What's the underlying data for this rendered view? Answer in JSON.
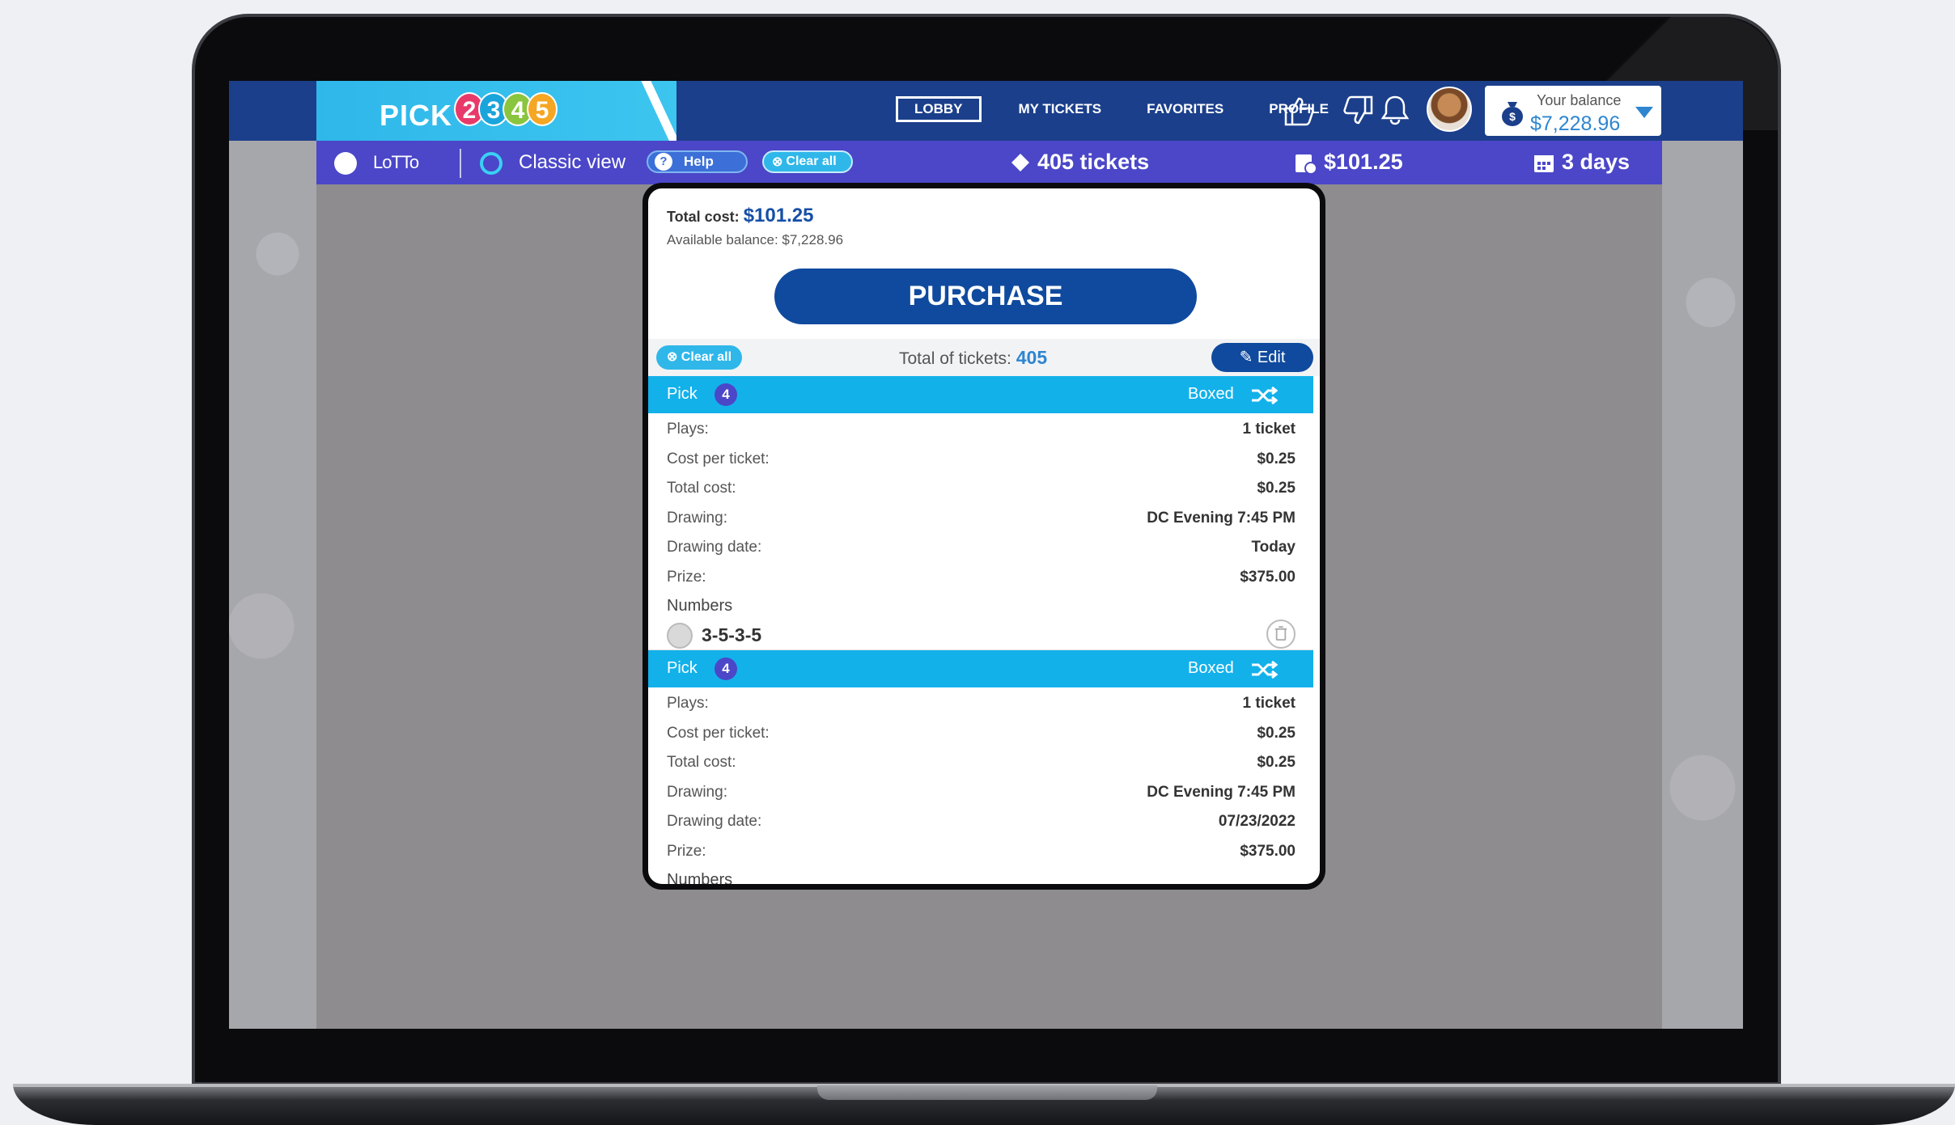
{
  "top_nav": {
    "logo_text": "PICK",
    "logo_digits": [
      "2",
      "3",
      "4",
      "5"
    ],
    "logo_colors": [
      "#e83a6a",
      "#1aa4dc",
      "#8ac53f",
      "#f5a623"
    ],
    "items": [
      {
        "label": "LOBBY",
        "active": true
      },
      {
        "label": "MY TICKETS",
        "active": false
      },
      {
        "label": "FAVORITES",
        "active": false
      },
      {
        "label": "PROFILE",
        "active": false
      }
    ],
    "icons": [
      "thumbs-up-icon",
      "thumbs-down-icon",
      "bell-icon"
    ],
    "balance_label": "Your balance",
    "balance_value": "$7,228.96"
  },
  "sub_bar": {
    "lotto_label": "LoTTo",
    "classic_view_label": "Classic view",
    "help_label": "Help",
    "clear_all_label": "Clear all",
    "tickets_label": "405 tickets",
    "cost_label": "$101.25",
    "days_label": "3 days"
  },
  "modal": {
    "total_cost_label": "Total cost:",
    "total_cost_value": "$101.25",
    "available_balance_text": "Available balance: $7,228.96",
    "purchase_label": "PURCHASE",
    "clear_all_label": "Clear all",
    "total_tickets_label": "Total of tickets:",
    "total_tickets_value": "405",
    "edit_label": "Edit",
    "tickets": [
      {
        "game": "Pick",
        "pick_number": "4",
        "type": "Boxed",
        "rows": [
          {
            "label": "Plays:",
            "value": "1 ticket"
          },
          {
            "label": "Cost per ticket:",
            "value": "$0.25"
          },
          {
            "label": "Total cost:",
            "value": "$0.25"
          },
          {
            "label": "Drawing:",
            "value": "DC Evening 7:45 PM"
          },
          {
            "label": "Drawing date:",
            "value": "Today"
          },
          {
            "label": "Prize:",
            "value": "$375.00"
          }
        ],
        "numbers_label": "Numbers",
        "numbers": "3-5-3-5"
      },
      {
        "game": "Pick",
        "pick_number": "4",
        "type": "Boxed",
        "rows": [
          {
            "label": "Plays:",
            "value": "1 ticket"
          },
          {
            "label": "Cost per ticket:",
            "value": "$0.25"
          },
          {
            "label": "Total cost:",
            "value": "$0.25"
          },
          {
            "label": "Drawing:",
            "value": "DC Evening 7:45 PM"
          },
          {
            "label": "Drawing date:",
            "value": "07/23/2022"
          },
          {
            "label": "Prize:",
            "value": "$375.00"
          }
        ],
        "numbers_label": "Numbers"
      }
    ]
  },
  "colors": {
    "nav_blue": "#1b3f8b",
    "sub_bar_purple": "#4b47c8",
    "header_cyan": "#13b1ea",
    "button_blue": "#0f4a9e"
  }
}
